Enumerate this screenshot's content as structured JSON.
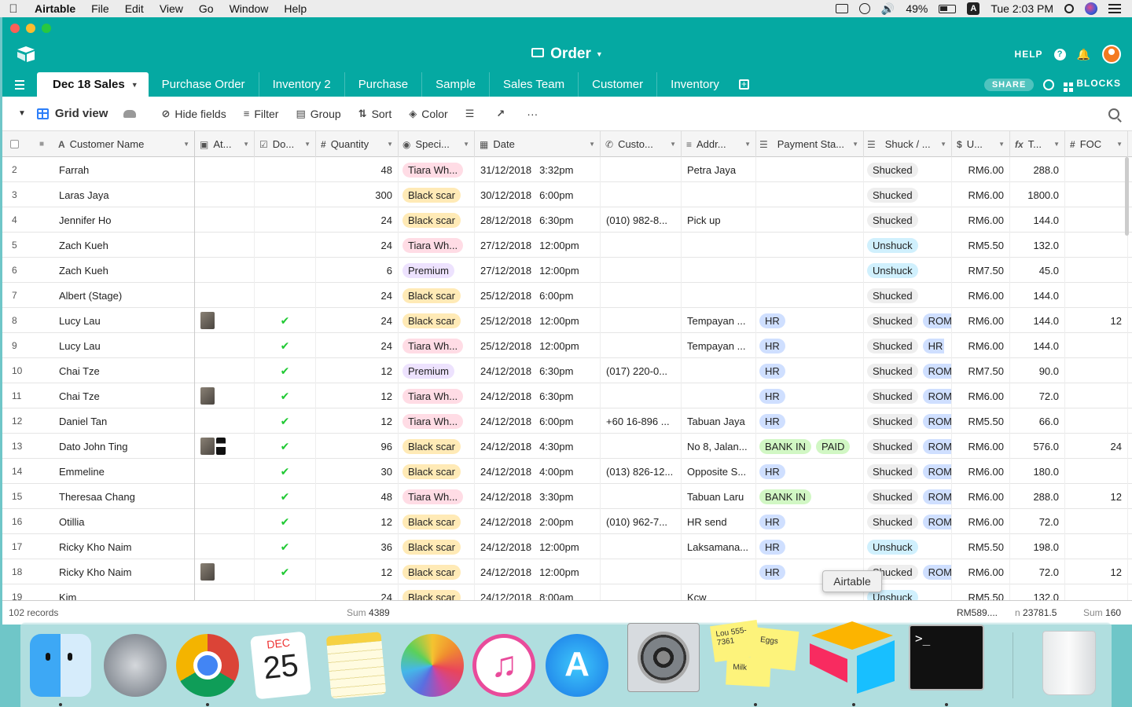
{
  "menubar": {
    "app": "Airtable",
    "items": [
      "File",
      "Edit",
      "View",
      "Go",
      "Window",
      "Help"
    ],
    "battery": "49%",
    "input_source": "A",
    "clock": "Tue 2:03 PM"
  },
  "window": {
    "base_title": "Order",
    "help_label": "HELP",
    "share_label": "SHARE",
    "blocks_label": "BLOCKS",
    "accent": "#05a9a2"
  },
  "tabs": [
    {
      "label": "Dec 18 Sales",
      "active": true
    },
    {
      "label": "Purchase Order"
    },
    {
      "label": "Inventory 2"
    },
    {
      "label": "Purchase"
    },
    {
      "label": "Sample"
    },
    {
      "label": "Sales Team"
    },
    {
      "label": "Customer"
    },
    {
      "label": "Inventory"
    }
  ],
  "toolbar": {
    "view_name": "Grid view",
    "hide_fields": "Hide fields",
    "filter": "Filter",
    "group": "Group",
    "sort": "Sort",
    "color": "Color",
    "more": "···"
  },
  "columns": {
    "name": "Customer Name",
    "att": "At...",
    "done": "Do...",
    "qty": "Quantity",
    "spec": "Speci...",
    "date": "Date",
    "phone": "Custo...",
    "addr": "Addr...",
    "pay": "Payment Sta...",
    "shuck": "Shuck / ...",
    "unit": "U...",
    "total": "T...",
    "foc": "FOC"
  },
  "rows": [
    {
      "idx": "2",
      "name": "Farrah",
      "qty": "48",
      "spec": "Tiara Wh...",
      "spec_color": "pink",
      "date": "31/12/2018",
      "time": "3:32pm",
      "phone": "",
      "addr": "Petra Jaya",
      "pay": [],
      "shuck": "Shucked",
      "shuck_color": "gray",
      "extra": "",
      "unit": "RM6.00",
      "total": "288.0",
      "foc": ""
    },
    {
      "idx": "3",
      "name": "Laras Jaya",
      "qty": "300",
      "spec": "Black scar",
      "spec_color": "yellow",
      "date": "30/12/2018",
      "time": "6:00pm",
      "phone": "",
      "addr": "",
      "pay": [],
      "shuck": "Shucked",
      "shuck_color": "gray",
      "extra": "",
      "unit": "RM6.00",
      "total": "1800.0",
      "foc": ""
    },
    {
      "idx": "4",
      "name": "Jennifer Ho",
      "qty": "24",
      "spec": "Black scar",
      "spec_color": "yellow",
      "date": "28/12/2018",
      "time": "6:30pm",
      "phone": "(010) 982-8...",
      "addr": "Pick up",
      "pay": [],
      "shuck": "Shucked",
      "shuck_color": "gray",
      "extra": "",
      "unit": "RM6.00",
      "total": "144.0",
      "foc": ""
    },
    {
      "idx": "5",
      "name": "Zach Kueh",
      "qty": "24",
      "spec": "Tiara Wh...",
      "spec_color": "pink",
      "date": "27/12/2018",
      "time": "12:00pm",
      "phone": "",
      "addr": "",
      "pay": [],
      "shuck": "Unshuck",
      "shuck_color": "cyan",
      "extra": "",
      "unit": "RM5.50",
      "total": "132.0",
      "foc": ""
    },
    {
      "idx": "6",
      "name": "Zach Kueh",
      "qty": "6",
      "spec": "Premium",
      "spec_color": "purple",
      "date": "27/12/2018",
      "time": "12:00pm",
      "phone": "",
      "addr": "",
      "pay": [],
      "shuck": "Unshuck",
      "shuck_color": "cyan",
      "extra": "",
      "unit": "RM7.50",
      "total": "45.0",
      "foc": ""
    },
    {
      "idx": "7",
      "name": "Albert (Stage)",
      "qty": "24",
      "spec": "Black scar",
      "spec_color": "yellow",
      "date": "25/12/2018",
      "time": "6:00pm",
      "phone": "",
      "addr": "",
      "pay": [],
      "shuck": "Shucked",
      "shuck_color": "gray",
      "extra": "",
      "unit": "RM6.00",
      "total": "144.0",
      "foc": ""
    },
    {
      "idx": "8",
      "name": "Lucy Lau",
      "att": 1,
      "done": true,
      "qty": "24",
      "spec": "Black scar",
      "spec_color": "yellow",
      "date": "25/12/2018",
      "time": "12:00pm",
      "phone": "",
      "addr": "Tempayan ...",
      "pay": [
        {
          "t": "HR",
          "c": "blue"
        }
      ],
      "shuck": "Shucked",
      "shuck_color": "gray",
      "extra": "ROM",
      "unit": "RM6.00",
      "total": "144.0",
      "foc": "12"
    },
    {
      "idx": "9",
      "name": "Lucy Lau",
      "done": true,
      "qty": "24",
      "spec": "Tiara Wh...",
      "spec_color": "pink",
      "date": "25/12/2018",
      "time": "12:00pm",
      "phone": "",
      "addr": "Tempayan ...",
      "pay": [
        {
          "t": "HR",
          "c": "blue"
        }
      ],
      "shuck": "Shucked",
      "shuck_color": "gray",
      "extra": "HR",
      "unit": "RM6.00",
      "total": "144.0",
      "foc": ""
    },
    {
      "idx": "10",
      "name": "Chai Tze",
      "done": true,
      "qty": "12",
      "spec": "Premium",
      "spec_color": "purple",
      "date": "24/12/2018",
      "time": "6:30pm",
      "phone": "(017) 220-0...",
      "addr": "",
      "pay": [
        {
          "t": "HR",
          "c": "blue"
        }
      ],
      "shuck": "Shucked",
      "shuck_color": "gray",
      "extra": "ROM",
      "unit": "RM7.50",
      "total": "90.0",
      "foc": ""
    },
    {
      "idx": "11",
      "name": "Chai Tze",
      "att": 1,
      "done": true,
      "qty": "12",
      "spec": "Tiara Wh...",
      "spec_color": "pink",
      "date": "24/12/2018",
      "time": "6:30pm",
      "phone": "",
      "addr": "",
      "pay": [
        {
          "t": "HR",
          "c": "blue"
        }
      ],
      "shuck": "Shucked",
      "shuck_color": "gray",
      "extra": "ROM",
      "unit": "RM6.00",
      "total": "72.0",
      "foc": ""
    },
    {
      "idx": "12",
      "name": "Daniel Tan",
      "done": true,
      "qty": "12",
      "spec": "Tiara Wh...",
      "spec_color": "pink",
      "date": "24/12/2018",
      "time": "6:00pm",
      "phone": "+60 16-896 ...",
      "addr": "Tabuan Jaya",
      "pay": [
        {
          "t": "HR",
          "c": "blue"
        }
      ],
      "shuck": "Shucked",
      "shuck_color": "gray",
      "extra": "ROM",
      "unit": "RM5.50",
      "total": "66.0",
      "foc": ""
    },
    {
      "idx": "13",
      "name": "Dato John Ting",
      "att": 2,
      "done": true,
      "qty": "96",
      "spec": "Black scar",
      "spec_color": "yellow",
      "date": "24/12/2018",
      "time": "4:30pm",
      "phone": "",
      "addr": "No 8, Jalan...",
      "pay": [
        {
          "t": "BANK IN",
          "c": "green"
        },
        {
          "t": "PAID",
          "c": "green"
        }
      ],
      "shuck": "Shucked",
      "shuck_color": "gray",
      "extra": "ROM",
      "unit": "RM6.00",
      "total": "576.0",
      "foc": "24"
    },
    {
      "idx": "14",
      "name": "Emmeline",
      "done": true,
      "qty": "30",
      "spec": "Black scar",
      "spec_color": "yellow",
      "date": "24/12/2018",
      "time": "4:00pm",
      "phone": "(013) 826-12...",
      "addr": "Opposite S...",
      "pay": [
        {
          "t": "HR",
          "c": "blue"
        }
      ],
      "shuck": "Shucked",
      "shuck_color": "gray",
      "extra": "ROM",
      "unit": "RM6.00",
      "total": "180.0",
      "foc": ""
    },
    {
      "idx": "15",
      "name": "Theresaa Chang",
      "done": true,
      "qty": "48",
      "spec": "Tiara Wh...",
      "spec_color": "pink",
      "date": "24/12/2018",
      "time": "3:30pm",
      "phone": "",
      "addr": "Tabuan Laru",
      "pay": [
        {
          "t": "BANK IN",
          "c": "green"
        }
      ],
      "shuck": "Shucked",
      "shuck_color": "gray",
      "extra": "ROM",
      "unit": "RM6.00",
      "total": "288.0",
      "foc": "12"
    },
    {
      "idx": "16",
      "name": "Otillia",
      "done": true,
      "qty": "12",
      "spec": "Black scar",
      "spec_color": "yellow",
      "date": "24/12/2018",
      "time": "2:00pm",
      "phone": "(010) 962-7...",
      "addr": "HR send",
      "pay": [
        {
          "t": "HR",
          "c": "blue"
        }
      ],
      "shuck": "Shucked",
      "shuck_color": "gray",
      "extra": "ROM",
      "unit": "RM6.00",
      "total": "72.0",
      "foc": ""
    },
    {
      "idx": "17",
      "name": "Ricky Kho Naim",
      "done": true,
      "qty": "36",
      "spec": "Black scar",
      "spec_color": "yellow",
      "date": "24/12/2018",
      "time": "12:00pm",
      "phone": "",
      "addr": "Laksamana...",
      "pay": [
        {
          "t": "HR",
          "c": "blue"
        }
      ],
      "shuck": "Unshuck",
      "shuck_color": "cyan",
      "extra": "",
      "unit": "RM5.50",
      "total": "198.0",
      "foc": ""
    },
    {
      "idx": "18",
      "name": "Ricky Kho Naim",
      "att": 1,
      "done": true,
      "qty": "12",
      "spec": "Black scar",
      "spec_color": "yellow",
      "date": "24/12/2018",
      "time": "12:00pm",
      "phone": "",
      "addr": "",
      "pay": [
        {
          "t": "HR",
          "c": "blue"
        }
      ],
      "shuck": "Shucked",
      "shuck_color": "gray",
      "extra": "ROM",
      "unit": "RM6.00",
      "total": "72.0",
      "foc": "12"
    },
    {
      "idx": "19",
      "name": "Kim",
      "qty": "24",
      "spec": "Black scar",
      "spec_color": "yellow",
      "date": "24/12/2018",
      "time": "8:00am",
      "phone": "",
      "addr": "Kcw",
      "pay": [],
      "shuck": "Unshuck",
      "shuck_color": "cyan",
      "extra": "",
      "unit": "RM5.50",
      "total": "132.0",
      "foc": ""
    }
  ],
  "footer": {
    "records": "102 records",
    "sum_label": "Sum",
    "qty_sum": "4389",
    "unit_sum": "RM589....",
    "total_prefix": "n",
    "total_sum": "23781.5",
    "foc_sum": "160"
  },
  "tooltip": "Airtable",
  "dock": {
    "calendar_month": "DEC",
    "calendar_day": "25",
    "sticky_1": "Lou 555-7361",
    "sticky_2": "Eggs",
    "sticky_3": "Milk",
    "terminal_prompt": ">_"
  }
}
